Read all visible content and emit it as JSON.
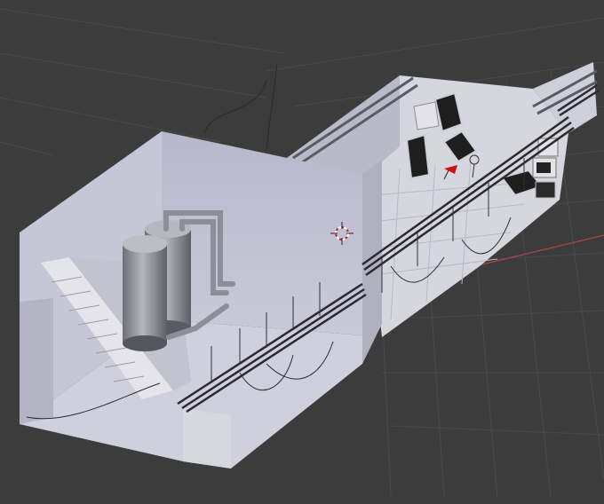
{
  "viewport": {
    "background": "#3c3c3c",
    "grid_color": "#4a4a4a",
    "x_axis_color": "#a8494a",
    "icons": [
      "3d-cursor-icon",
      "lamp-icon",
      "camera-icon"
    ]
  },
  "scene": {
    "wall_color": "#c9cad6",
    "floor_color": "#d4d4dc",
    "equipment_color": "#9a9aa2",
    "monitor_color": "#1e1e1e",
    "cable_tray_color": "#2a2a30"
  }
}
